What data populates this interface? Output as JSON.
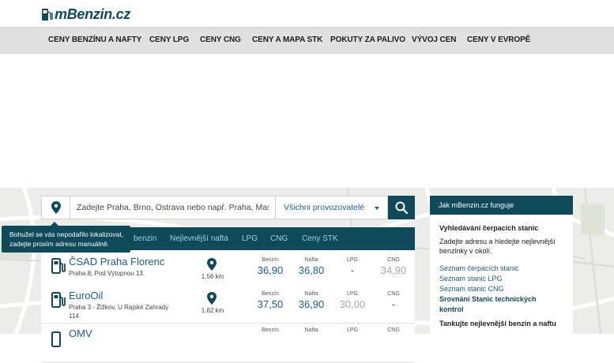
{
  "header": {
    "logo": "mBenzin.cz",
    "nav": [
      {
        "label": "CENY BENZÍNU A NAFTY",
        "name": "nav-ceny-benzinu-a-nafty"
      },
      {
        "label": "CENY LPG",
        "name": "nav-ceny-lpg"
      },
      {
        "label": "CENY CNG",
        "name": "nav-ceny-cng"
      },
      {
        "label": "CENY A MAPA STK",
        "name": "nav-ceny-a-mapa-stk"
      },
      {
        "label": "POKUTY ZA PALIVO",
        "name": "nav-pokuty-za-palivo"
      },
      {
        "label": "VÝVOJ CEN",
        "name": "nav-vyvoj-cen"
      },
      {
        "label": "CENY V EVROPĚ",
        "name": "nav-ceny-v-evrope"
      }
    ]
  },
  "search": {
    "placeholder": "Zadejte Praha, Brno, Ostrava nebo např. Praha, Masaryk",
    "value": "",
    "provider": "Všichni provozovatelé"
  },
  "tooltip": {
    "line1": "Bohužel se vás nepodařilo lokalizovat,",
    "line2": "zadejte prosím adresu manuálně."
  },
  "tabs": [
    {
      "label": "benzin",
      "name": "tab-benzin"
    },
    {
      "label": "Nejlevnější nafta",
      "name": "tab-nejlevnejsi-nafta"
    },
    {
      "label": "LPG",
      "name": "tab-lpg"
    },
    {
      "label": "CNG",
      "name": "tab-cng"
    },
    {
      "label": "Ceny STK",
      "name": "tab-ceny-stk"
    }
  ],
  "columns": {
    "benzin": "Benzín",
    "nafta": "Nafta",
    "lpg": "LPG",
    "cng": "CNG"
  },
  "stations": [
    {
      "name": "ČSAD Praha Florenc",
      "address": "Praha 8, Pod Výtopnou 13",
      "distance": "1.56 km",
      "benzin": "36,90",
      "nafta": "36,80",
      "lpg": "-",
      "cng": "34,90",
      "benzin_style": "hi",
      "nafta_style": "hi",
      "lpg_style": "dash",
      "cng_style": "lo"
    },
    {
      "name": "EuroOil",
      "address": "Praha 3 - Žižkov, U Rajské Zahrady 114",
      "distance": "1.62 km",
      "benzin": "37,50",
      "nafta": "36,90",
      "lpg": "30,00",
      "cng": "-",
      "benzin_style": "hi",
      "nafta_style": "hi",
      "lpg_style": "lo",
      "cng_style": "dash"
    },
    {
      "name": "OMV",
      "address": "",
      "distance": "",
      "benzin": "",
      "nafta": "",
      "lpg": "",
      "cng": "",
      "benzin_style": "hi",
      "nafta_style": "hi",
      "lpg_style": "lo",
      "cng_style": "lo"
    }
  ],
  "info": {
    "head": "Jak mBenzin.cz funguje",
    "heading": "Vyhledávání čerpacích stanic",
    "text": "Zadejte adresu a hledejte nejlevnější benzinky v okolí.",
    "links": [
      {
        "label": "Seznam čerpacích stanic",
        "bold": false
      },
      {
        "label": "Seznam stanic LPG",
        "bold": false
      },
      {
        "label": "Seznam stanic CNG",
        "bold": false
      },
      {
        "label": "Srovnání Stanic technických kontrol",
        "bold": true
      }
    ],
    "heading2": "Tankujte nejlevnější benzin a naftu"
  },
  "colors": {
    "brand": "#0f4a5a",
    "link": "#1a5e84",
    "nav_bg": "#e1e1e1"
  }
}
